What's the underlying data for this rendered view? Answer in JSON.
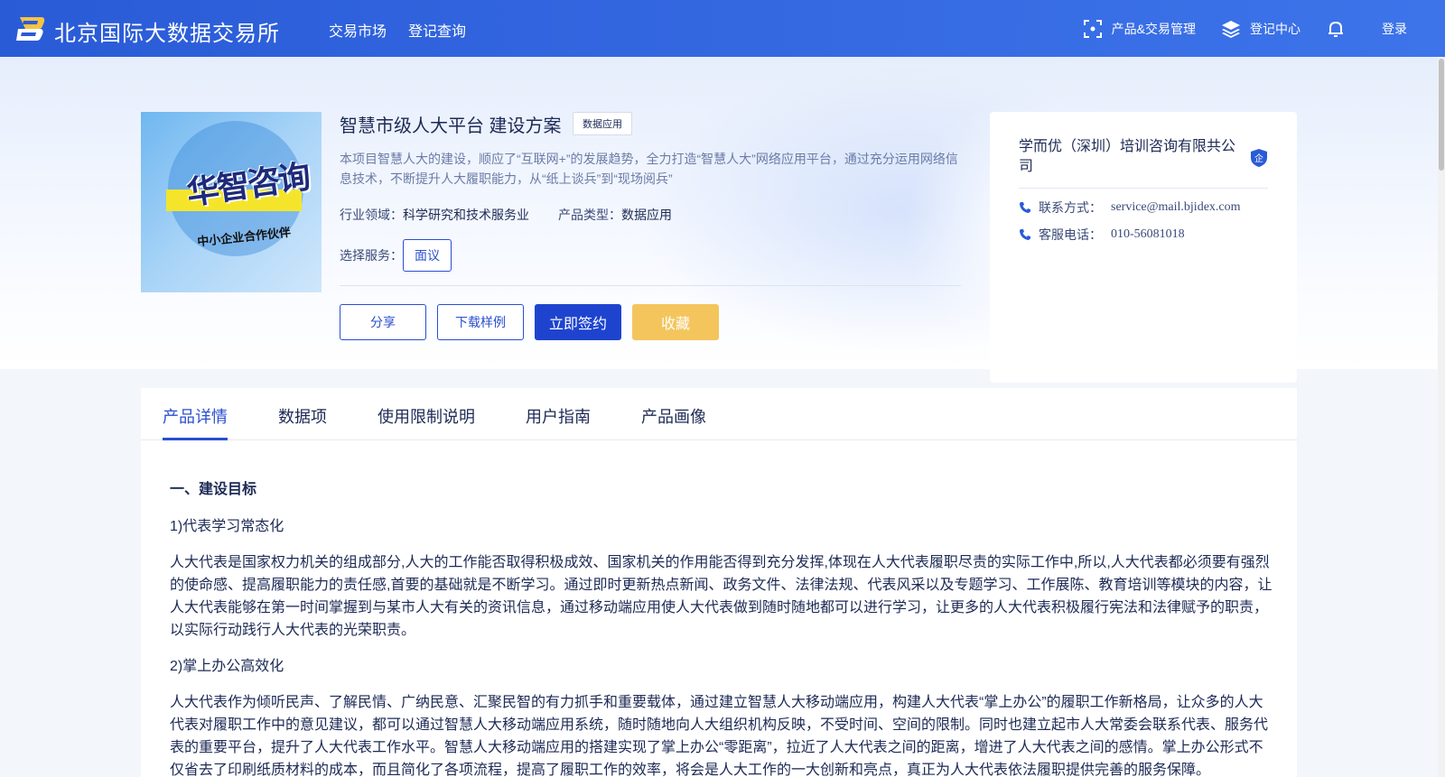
{
  "header": {
    "brand": "北京国际大数据交易所",
    "nav": [
      "交易市场",
      "登记查询"
    ],
    "product_mgmt": "产品&交易管理",
    "register_center": "登记中心",
    "login": "登录"
  },
  "product": {
    "image_title": "华智咨询",
    "image_subtitle": "中小企业合作伙伴",
    "title": "智慧市级人大平台 建设方案",
    "tag": "数据应用",
    "description": "本项目智慧人大的建设，顺应了“互联网+”的发展趋势，全力打造“智慧人大”网络应用平台，通过充分运用网络信息技术，不断提升人大履职能力，从“纸上谈兵”到“现场阅兵”",
    "industry_label": "行业领域：",
    "industry_value": "科学研究和技术服务业",
    "type_label": "产品类型：",
    "type_value": "数据应用",
    "service_label": "选择服务：",
    "service_option": "面议",
    "buttons": {
      "share": "分享",
      "download_sample": "下载样例",
      "sign_now": "立即签约",
      "favorite": "收藏"
    }
  },
  "vendor": {
    "name": "学而优（深圳）培训咨询有限共公司",
    "badge": "企",
    "contact_label": "联系方式：",
    "contact_value": "service@mail.bjidex.com",
    "phone_label": "客服电话：",
    "phone_value": "010-56081018"
  },
  "tabs": [
    "产品详情",
    "数据项",
    "使用限制说明",
    "用户指南",
    "产品画像"
  ],
  "detail": {
    "heading": "一、建设目标",
    "sub1": "1)代表学习常态化",
    "para1": "人大代表是国家权力机关的组成部分,人大的工作能否取得积极成效、国家机关的作用能否得到充分发挥,体现在人大代表履职尽责的实际工作中,所以,人大代表都必须要有强烈的使命感、提高履职能力的责任感,首要的基础就是不断学习。通过即时更新热点新闻、政务文件、法律法规、代表风采以及专题学习、工作展陈、教育培训等模块的内容，让人大代表能够在第一时间掌握到与某市人大有关的资讯信息，通过移动端应用使人大代表做到随时随地都可以进行学习，让更多的人大代表积极履行宪法和法律赋予的职责，以实际行动践行人大代表的光荣职责。",
    "sub2": "2)掌上办公高效化",
    "para2": "人大代表作为倾听民声、了解民情、广纳民意、汇聚民智的有力抓手和重要载体，通过建立智慧人大移动端应用，构建人大代表“掌上办公”的履职工作新格局，让众多的人大代表对履职工作中的意见建议，都可以通过智慧人大移动端应用系统，随时随地向人大组织机构反映，不受时间、空间的限制。同时也建立起市人大常委会联系代表、服务代表的重要平台，提升了人大代表工作水平。智慧人大移动端应用的搭建实现了掌上办公“零距离”，拉近了人大代表之间的距离，增进了人大代表之间的感情。掌上办公形式不仅省去了印刷纸质材料的成本，而且简化了各项流程，提高了履职工作的效率，将会是人大工作的一大创新和亮点，真正为人大代表依法履职提供完善的服务保障。"
  }
}
